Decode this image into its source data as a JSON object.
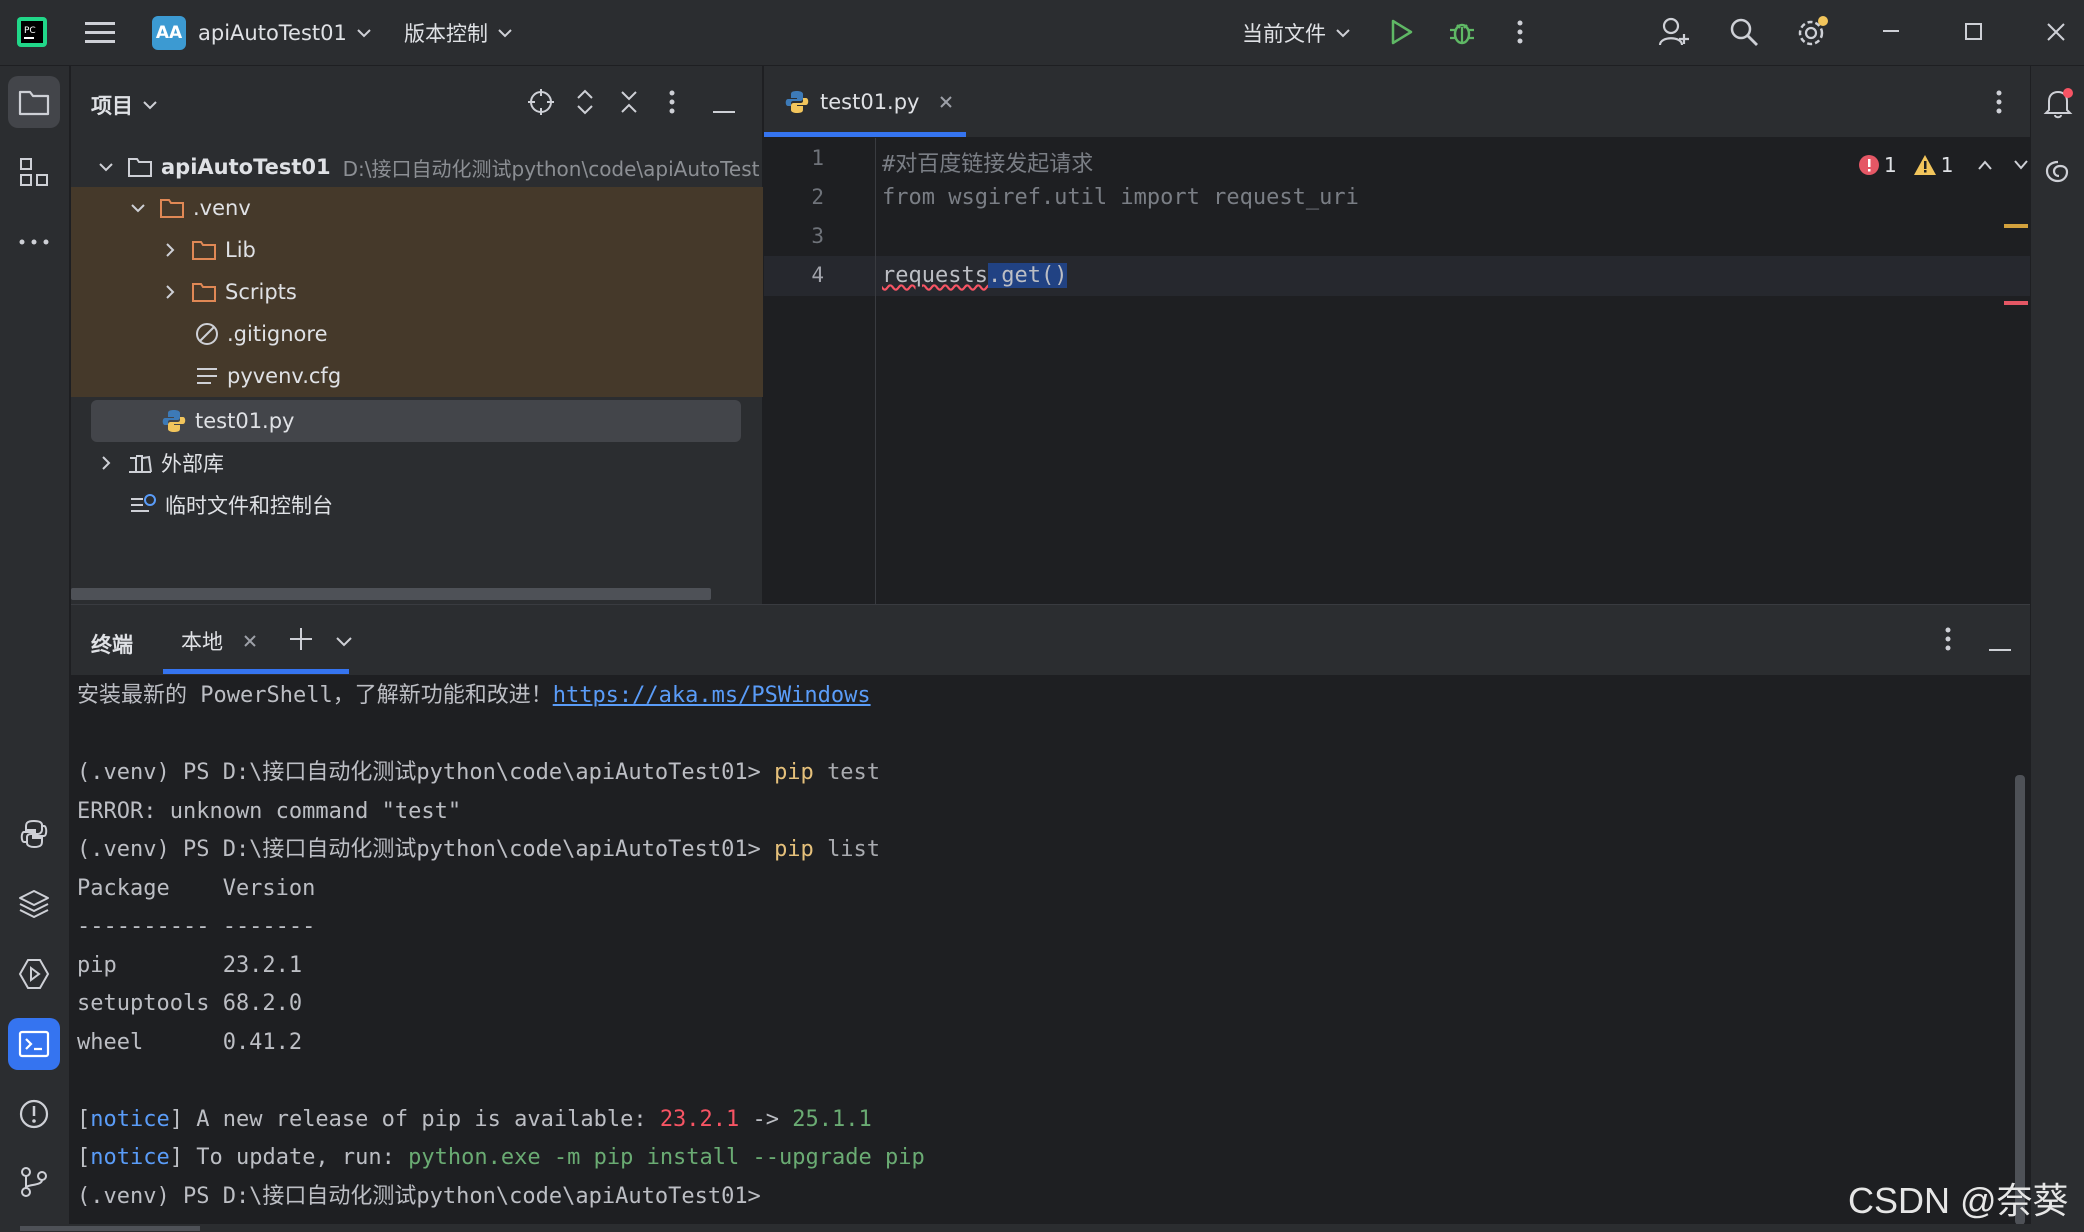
{
  "titlebar": {
    "project_badge": "AA",
    "project_name": "apiAutoTest01",
    "vcs_label": "版本控制",
    "run_config": "当前文件"
  },
  "project_panel": {
    "title": "项目",
    "root_name": "apiAutoTest01",
    "root_path": "D:\\接口自动化测试python\\code\\apiAutoTest",
    "venv": ".venv",
    "lib": "Lib",
    "scripts": "Scripts",
    "gitignore": ".gitignore",
    "pyvenv": "pyvenv.cfg",
    "file": "test01.py",
    "external": "外部库",
    "scratches": "临时文件和控制台"
  },
  "editor": {
    "tab_name": "test01.py",
    "error_count": "1",
    "warning_count": "1",
    "lines": [
      {
        "num": "1",
        "text": "#对百度链接发起请求"
      },
      {
        "num": "2",
        "text": "from wsgiref.util import request_uri"
      },
      {
        "num": "3",
        "text": ""
      },
      {
        "num": "4",
        "text_a": "requests",
        "text_b": ".get()"
      }
    ]
  },
  "terminal": {
    "title": "终端",
    "tab_local": "本地",
    "l1_text": "安装最新的 PowerShell，了解新功能和改进！",
    "l1_link": "https://aka.ms/PSWindows",
    "prompt": "(.venv) PS D:\\接口自动化测试python\\code\\apiAutoTest01>",
    "cmd1_a": "pip",
    "cmd1_b": "test",
    "error": "ERROR: unknown command \"test\"",
    "cmd2_a": "pip",
    "cmd2_b": "list",
    "hdr": "Package    Version",
    "sep": "---------- -------",
    "pkg1": "pip        23.2.1",
    "pkg2": "setuptools 68.2.0",
    "pkg3": "wheel      0.41.2",
    "notice": "notice",
    "n1_text": " A new release of pip is available: ",
    "n1_old": "23.2.1",
    "n1_arrow": " -> ",
    "n1_new": "25.1.1",
    "n2_text": " To update, run: ",
    "n2_cmd": "python.exe -m pip install --upgrade pip"
  },
  "watermark": "CSDN @奈葵"
}
